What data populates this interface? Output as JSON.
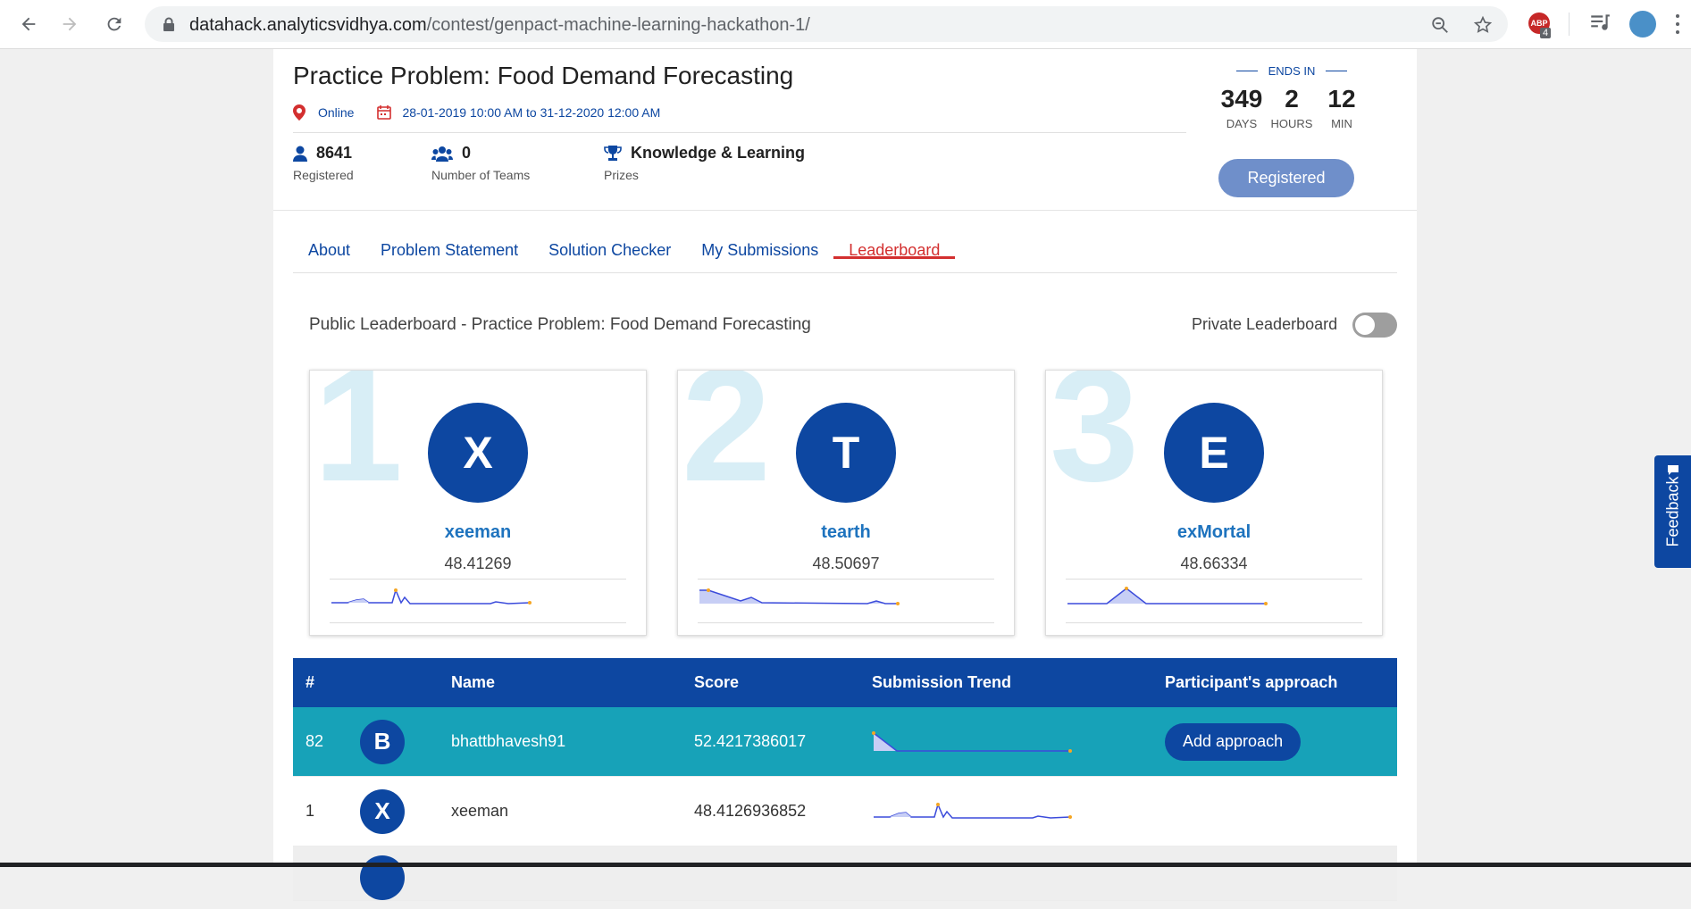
{
  "browser": {
    "url_host": "datahack.analyticsvidhya.com",
    "url_path": "/contest/genpact-machine-learning-hackathon-1/",
    "ext_badge": "ABP",
    "ext_count": "4"
  },
  "contest": {
    "title": "Practice Problem: Food Demand Forecasting",
    "location": "Online",
    "dates": "28-01-2019 10:00 AM to 31-12-2020 12:00 AM",
    "registered_count": "8641",
    "registered_label": "Registered",
    "teams_count": "0",
    "teams_label": "Number of Teams",
    "prize_value": "Knowledge & Learning",
    "prize_label": "Prizes"
  },
  "countdown": {
    "label": "ENDS IN",
    "days": "349",
    "days_label": "DAYS",
    "hours": "2",
    "hours_label": "HOURS",
    "min": "12",
    "min_label": "MIN",
    "registered_button": "Registered"
  },
  "tabs": [
    {
      "label": "About"
    },
    {
      "label": "Problem Statement"
    },
    {
      "label": "Solution Checker"
    },
    {
      "label": "My Submissions"
    },
    {
      "label": "Leaderboard",
      "active": true
    }
  ],
  "leaderboard": {
    "title": "Public Leaderboard - Practice Problem: Food Demand Forecasting",
    "private_label": "Private Leaderboard",
    "private_enabled": false
  },
  "top3": [
    {
      "rank": "1",
      "initial": "X",
      "name": "xeeman",
      "score": "48.41269"
    },
    {
      "rank": "2",
      "initial": "T",
      "name": "tearth",
      "score": "48.50697"
    },
    {
      "rank": "3",
      "initial": "E",
      "name": "exMortal",
      "score": "48.66334"
    }
  ],
  "table": {
    "headers": {
      "rank": "#",
      "name": "Name",
      "score": "Score",
      "trend": "Submission Trend",
      "approach": "Participant's approach"
    },
    "rows": [
      {
        "rank": "82",
        "initial": "B",
        "name": "bhattbhavesh91",
        "score": "52.4217386017",
        "approach_button": "Add approach"
      },
      {
        "rank": "1",
        "initial": "X",
        "name": "xeeman",
        "score": "48.4126936852",
        "approach_button": ""
      }
    ]
  },
  "feedback": "Feedback",
  "colors": {
    "brand": "#0d47a1",
    "accent_red": "#d32f2f",
    "highlight_row": "#17a2b8"
  }
}
